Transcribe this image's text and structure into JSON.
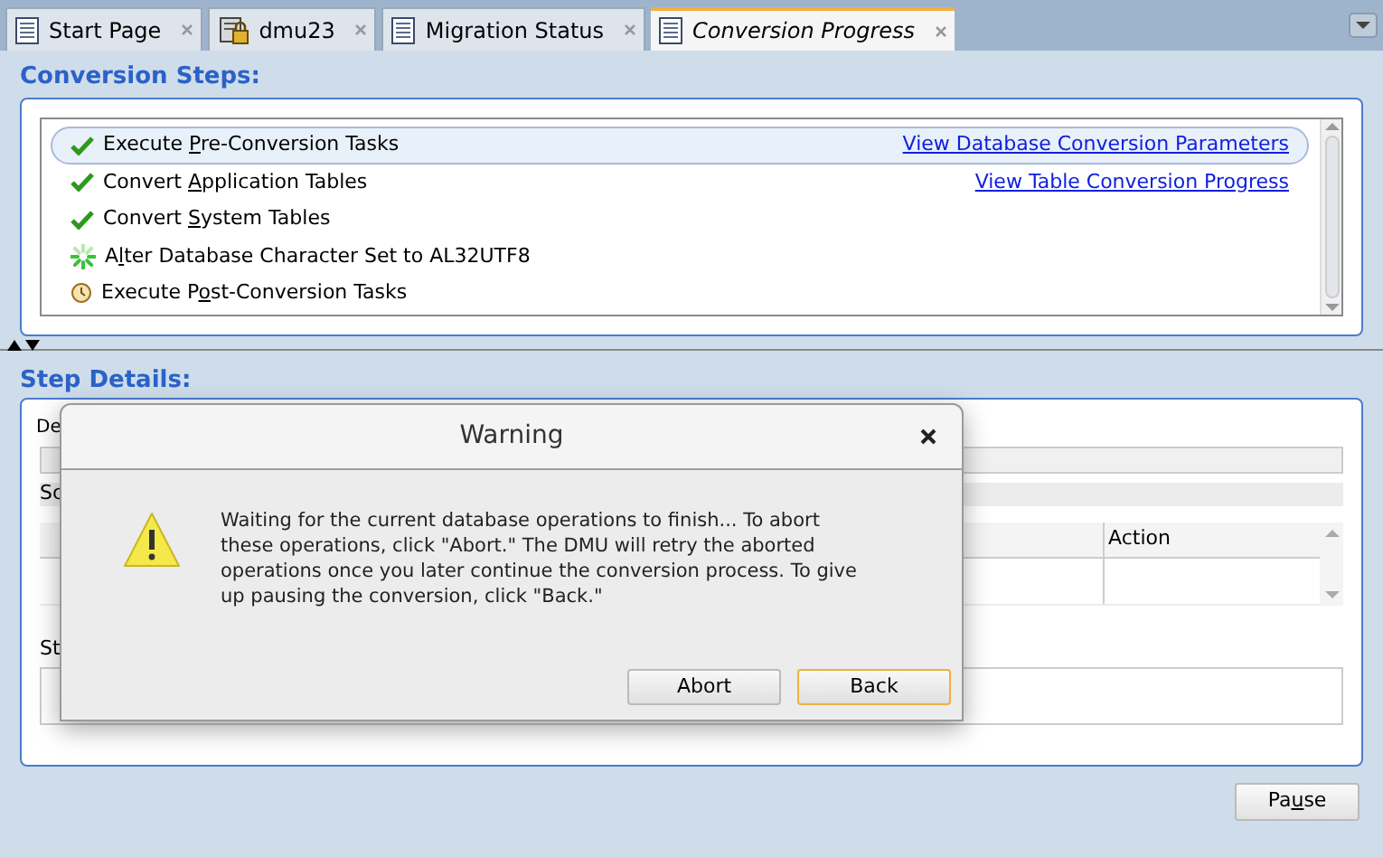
{
  "tabs": [
    {
      "label": "Start Page",
      "kind": "page",
      "selected": false
    },
    {
      "label": "dmu23",
      "kind": "database",
      "selected": false
    },
    {
      "label": "Migration Status",
      "kind": "page",
      "selected": false
    },
    {
      "label": "Conversion Progress",
      "kind": "page",
      "selected": true
    }
  ],
  "conversion_steps": {
    "title": "Conversion Steps:",
    "steps": [
      {
        "label": [
          "Execute ",
          "P",
          "re-Conversion Tasks"
        ],
        "kind": "done",
        "selected": true,
        "link": "View Database Conversion Parameters"
      },
      {
        "label": [
          "Convert ",
          "A",
          "pplication Tables"
        ],
        "kind": "done",
        "selected": false,
        "link": "View Table Conversion Progress"
      },
      {
        "label": [
          "Convert ",
          "S",
          "ystem Tables"
        ],
        "kind": "done",
        "selected": false
      },
      {
        "label": [
          "A",
          "l",
          "ter Database Character Set to AL32UTF8"
        ],
        "kind": "running",
        "selected": false
      },
      {
        "label": [
          "Execute P",
          "o",
          "st-Conversion Tasks"
        ],
        "kind": "pending",
        "selected": false
      }
    ]
  },
  "step_details": {
    "title": "Step Details:",
    "label_1": "De",
    "label_2": "Sc",
    "table": {
      "columns": [
        "Action"
      ]
    },
    "label_3": "St"
  },
  "pause_button": [
    "Pa",
    "u",
    "se"
  ],
  "dialog": {
    "title": "Warning",
    "message": "Waiting for the current database operations to finish... To abort these operations, click \"Abort.\" The DMU will retry the aborted operations once you later continue the conversion process. To give up pausing the conversion, click \"Back.\"",
    "buttons": [
      {
        "label": "Abort",
        "selected": false
      },
      {
        "label": "Back",
        "selected": true
      }
    ]
  }
}
